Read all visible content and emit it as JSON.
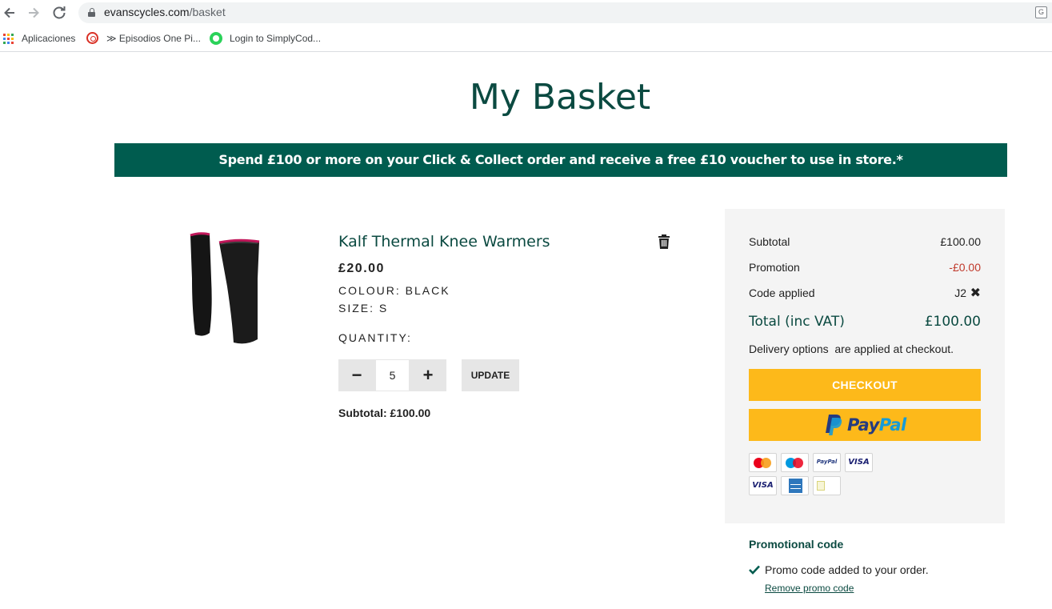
{
  "browser": {
    "url_domain": "evanscycles.com",
    "url_path": "/basket",
    "bookmarks": [
      {
        "label": "Aplicaciones"
      },
      {
        "label": "≫ Episodios One Pi..."
      },
      {
        "label": "Login to SimplyCod..."
      }
    ]
  },
  "page": {
    "title": "My Basket",
    "banner": "Spend £100 or more on your Click & Collect order and receive a free £10 voucher to use in store.*"
  },
  "product": {
    "name": "Kalf Thermal Knee Warmers",
    "price": "£20.00",
    "colour": "COLOUR: BLACK",
    "size": "SIZE: S",
    "quantity_label": "QUANTITY:",
    "quantity": "5",
    "minus_label": "−",
    "plus_label": "+",
    "update_label": "UPDATE",
    "subtotal": "Subtotal: £100.00"
  },
  "summary": {
    "subtotal_label": "Subtotal",
    "subtotal_value": "£100.00",
    "promotion_label": "Promotion",
    "promotion_value": "-£0.00",
    "code_label": "Code applied",
    "code_value": "J2",
    "remove_code_symbol": "✖",
    "total_label": "Total (inc VAT)",
    "total_value": "£100.00",
    "delivery_note": "Delivery options  are applied at checkout.",
    "checkout_label": "CHECKOUT",
    "paypal_pay": "Pay",
    "paypal_pal": "Pal",
    "payment_icons": [
      "mastercard-icon",
      "maestro-icon",
      "paypal-icon",
      "visa-icon",
      "visa-icon",
      "amex-icon",
      "retail-finance-icon"
    ],
    "visa_text": "VISA",
    "paypal_mini_text": "PayPal"
  },
  "promo": {
    "heading": "Promotional code",
    "message": "Promo code added to your order.",
    "remove_link": "Remove promo code"
  },
  "colors": {
    "brand_green": "#005c4f",
    "title_green": "#0b4a41",
    "checkout_yellow": "#fdb91a",
    "promotion_red": "#c0392b"
  }
}
